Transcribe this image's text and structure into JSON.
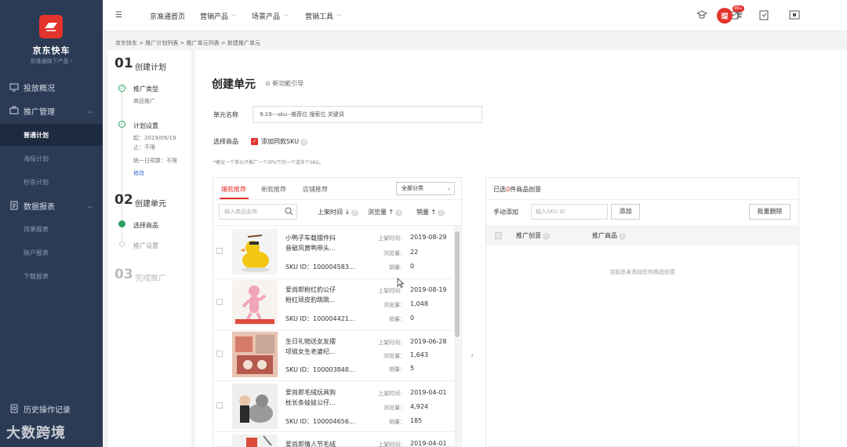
{
  "sidebar": {
    "brand": "京东快车",
    "brand_sub": "京准通旗下产品 ›",
    "nav": [
      {
        "label": "投放概况"
      },
      {
        "label": "推广管理"
      },
      {
        "label": "数据报表"
      }
    ],
    "sub_promo": [
      "普通计划",
      "海投计划",
      "秒杀计划"
    ],
    "sub_report": [
      "效果报表",
      "账户报表",
      "下载报表"
    ],
    "history": "历史操作记录"
  },
  "watermark": "大数跨境",
  "topbar": {
    "menu": [
      "京准通首页",
      "营销产品",
      "场景产品",
      "营销工具"
    ],
    "badge": "99+",
    "avatar_char": "琛",
    "user_short": "爱"
  },
  "breadcrumb": "京东快车 > 推广计划列表 > 推广单元列表 > 新建推广单元",
  "steps": {
    "step1": {
      "num": "01",
      "title": "创建计划"
    },
    "sub1": {
      "label": "推广类型",
      "info": "商品推广"
    },
    "sub2": {
      "label": "计划设置",
      "info1": "起：2019/09/19",
      "info2": "止：不限",
      "info3": "统一日预算：不限",
      "edit": "修改"
    },
    "step2": {
      "num": "02",
      "title": "创建单元"
    },
    "sub3": {
      "label": "选择商品"
    },
    "sub4": {
      "label": "推广设置"
    },
    "step3": {
      "num": "03",
      "title": "完成推广"
    }
  },
  "main": {
    "title": "创建单元",
    "guide": "新功能引导",
    "unit_name_label": "单元名称",
    "unit_name_value": "9.19---sku--推荐位 搜索位 关键词",
    "select_goods_label": "选择商品",
    "add_same_sku": "添加同款SKU",
    "hint": "*建议一个单元只推广一个SPU下的一个或多个SKU。"
  },
  "left": {
    "tabs": [
      "爆款推荐",
      "新款推荐",
      "店铺推荐"
    ],
    "category": "全部分类",
    "search_placeholder": "输入商品名称",
    "sort": [
      "上架时间",
      "浏览量",
      "销量"
    ],
    "labels": {
      "time": "上架时间：",
      "views": "浏览量：",
      "sales": "销量："
    },
    "products": [
      {
        "name1": "小鸭子车载摆件抖",
        "name2": "音破风黄鸭带头...",
        "sku": "SKU ID：100004583...",
        "time": "2019-08-29",
        "views": "22",
        "sales": "0"
      },
      {
        "name1": "爱尚郎粉红豹公仔",
        "name2": "粉红顽皮豹跳跳...",
        "sku": "SKU ID：100004421...",
        "time": "2019-08-19",
        "views": "1,048",
        "sales": "0"
      },
      {
        "name1": "生日礼物送女友摆",
        "name2": "项链女生老婆纪...",
        "sku": "SKU ID：100003848...",
        "time": "2019-06-28",
        "views": "1,643",
        "sales": "5"
      },
      {
        "name1": "爱尚郎毛绒玩具狗",
        "name2": "枕长条娃娃公仔...",
        "sku": "SKU ID：100004656...",
        "time": "2019-04-01",
        "views": "4,924",
        "sales": "185"
      },
      {
        "name1": "爱尚郎情人节毛绒",
        "time": "2019-04-01"
      }
    ]
  },
  "right": {
    "selected_prefix": "已选",
    "selected_num": "0",
    "selected_suffix": "件商品创意",
    "manual_add": "手动添加",
    "sku_placeholder": "输入SKU ID",
    "add_btn": "添加",
    "batch_delete": "批量删除",
    "col_creative": "推广创意",
    "col_goods": "推广商品",
    "empty": "当前还未添加任何商品创意"
  },
  "colors": {
    "sidebar": "#2c3b55",
    "accent": "#e2332c",
    "success": "#29a05c"
  }
}
